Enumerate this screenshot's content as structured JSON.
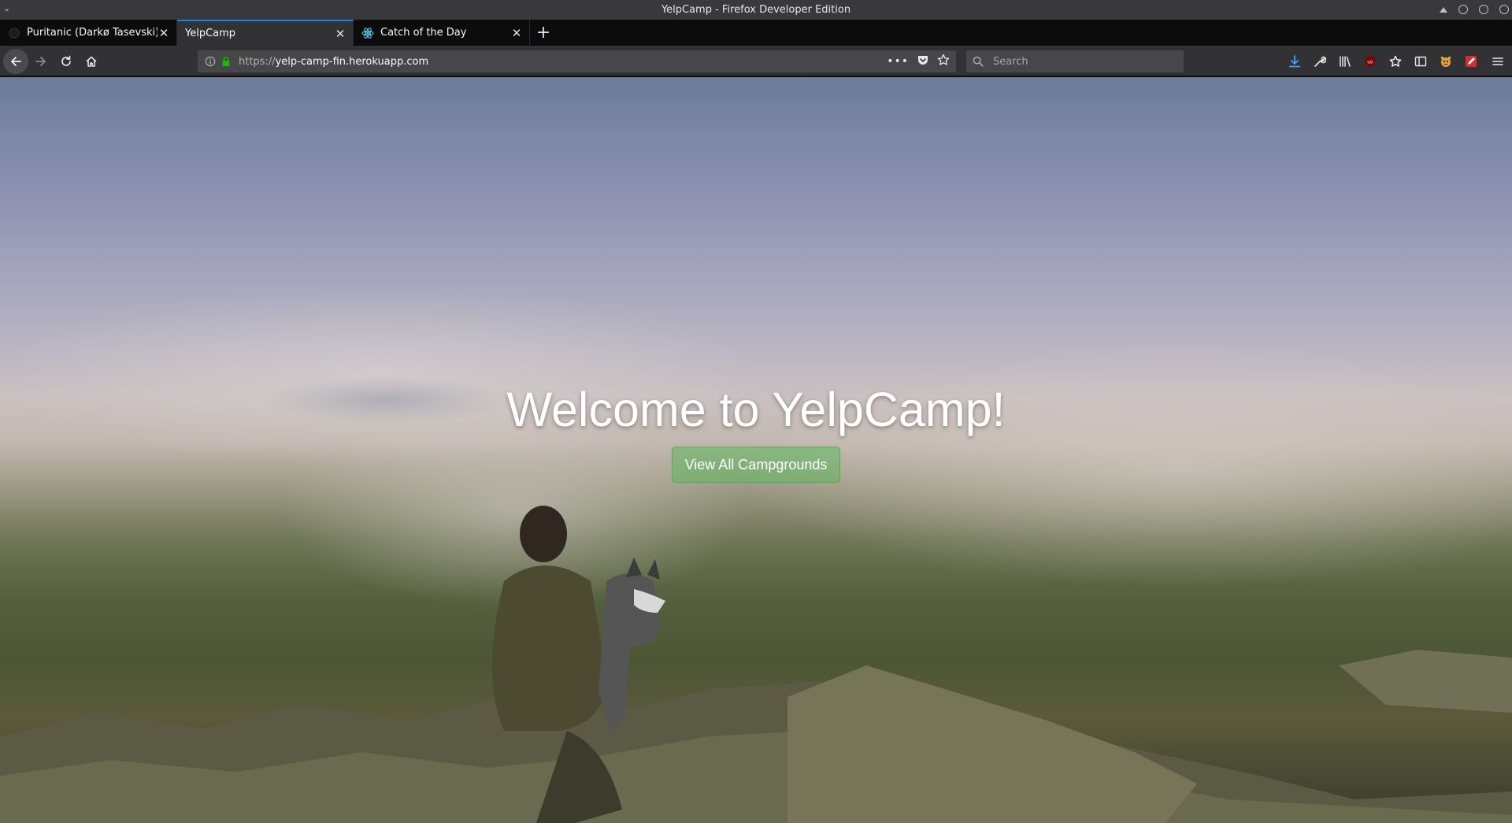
{
  "window": {
    "title": "YelpCamp - Firefox Developer Edition"
  },
  "tabs": [
    {
      "label": "Puritanic (Darkø Tasevski)",
      "selected": false,
      "icon": "github-icon"
    },
    {
      "label": "YelpCamp",
      "selected": true,
      "icon": ""
    },
    {
      "label": "Catch of the Day",
      "selected": false,
      "icon": "react-icon"
    }
  ],
  "navbar": {
    "url_scheme": "https://",
    "url_host": "yelp-camp-fin.herokuapp.com",
    "search_placeholder": "Search"
  },
  "page": {
    "heading": "Welcome to YelpCamp!",
    "cta_label": "View All Campgrounds"
  },
  "colors": {
    "accent": "#0a84ff",
    "button": "#5cb85c",
    "lock": "#12bc00"
  }
}
